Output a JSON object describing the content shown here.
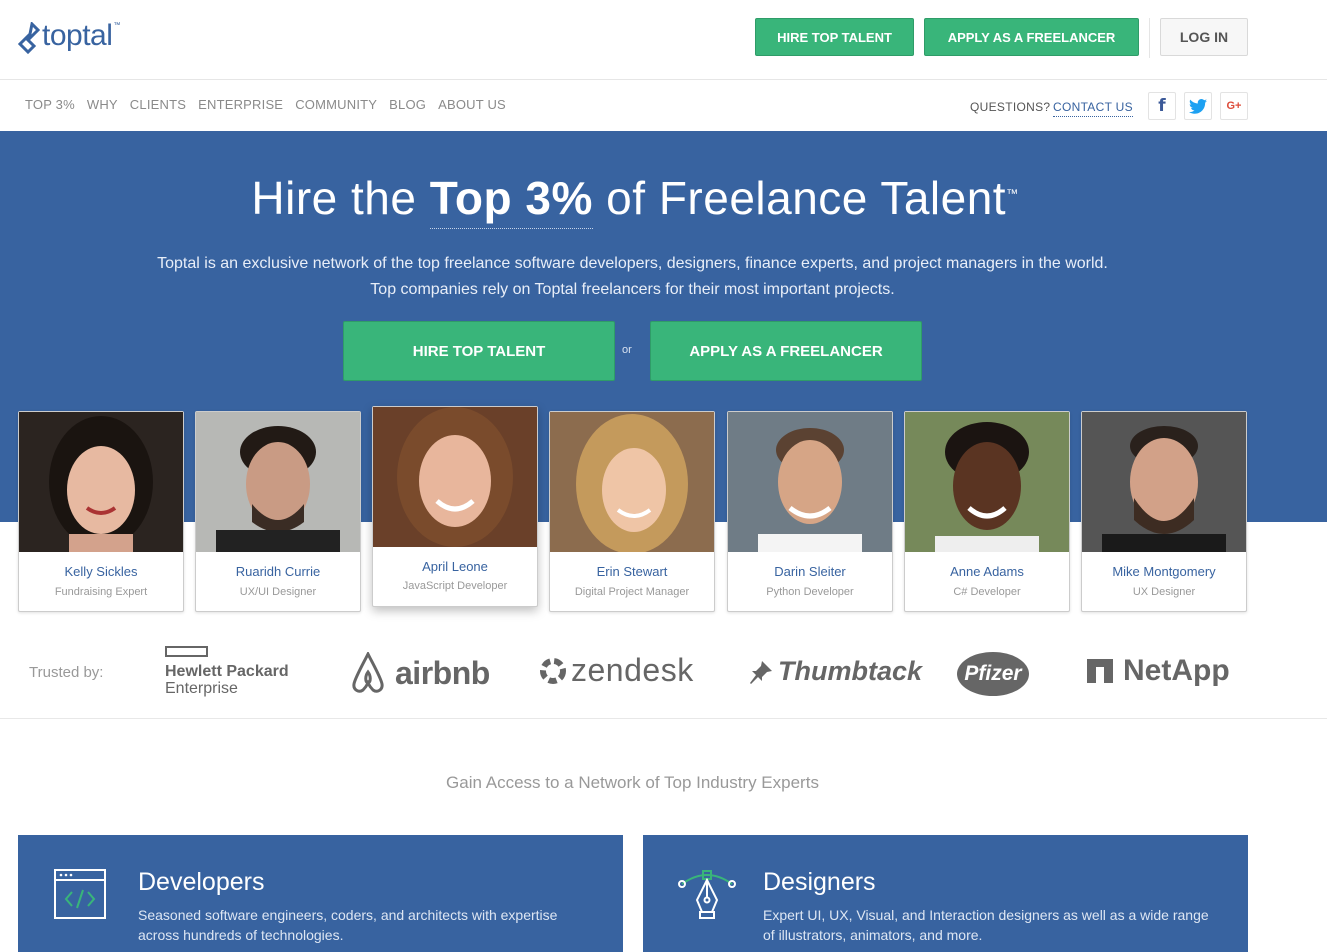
{
  "brand": {
    "name": "toptal",
    "tm": "™"
  },
  "header": {
    "hire_label": "HIRE TOP TALENT",
    "apply_label": "APPLY AS A FREELANCER",
    "login_label": "LOG IN"
  },
  "nav": {
    "items": [
      "TOP 3%",
      "WHY",
      "CLIENTS",
      "ENTERPRISE",
      "COMMUNITY",
      "BLOG",
      "ABOUT US"
    ],
    "questions": "QUESTIONS?",
    "contact": "CONTACT US",
    "social": {
      "facebook": "f",
      "twitter": "twitter-icon",
      "google_plus": "G+"
    }
  },
  "hero": {
    "title_pre": "Hire the ",
    "title_strong": "Top 3%",
    "title_post": " of Freelance Talent",
    "title_tm": "™",
    "subtitle_line1": "Toptal is an exclusive network of the top freelance software developers, designers, finance experts, and project managers in the world.",
    "subtitle_line2": "Top companies rely on Toptal freelancers for their most important projects.",
    "hire_label": "HIRE TOP TALENT",
    "or_label": "or",
    "apply_label": "APPLY AS A FREELANCER"
  },
  "talent": [
    {
      "name": "Kelly Sickles",
      "role": "Fundraising Expert"
    },
    {
      "name": "Ruaridh Currie",
      "role": "UX/UI Designer"
    },
    {
      "name": "April Leone",
      "role": "JavaScript Developer"
    },
    {
      "name": "Erin Stewart",
      "role": "Digital Project Manager"
    },
    {
      "name": "Darin Sleiter",
      "role": "Python Developer"
    },
    {
      "name": "Anne Adams",
      "role": "C# Developer"
    },
    {
      "name": "Mike Montgomery",
      "role": "UX Designer"
    }
  ],
  "trusted": {
    "label": "Trusted by:",
    "hpe_line1": "Hewlett Packard",
    "hpe_line2": "Enterprise",
    "airbnb": "airbnb",
    "zendesk": "zendesk",
    "thumbtack": "Thumbtack",
    "pfizer": "Pfizer",
    "netapp": "NetApp"
  },
  "section": {
    "title": "Gain Access to a Network of Top Industry Experts",
    "panels": [
      {
        "title": "Developers",
        "desc": "Seasoned software engineers, coders, and architects with expertise across hundreds of technologies."
      },
      {
        "title": "Designers",
        "desc": "Expert UI, UX, Visual, and Interaction designers as well as a wide range of illustrators, animators, and more."
      }
    ]
  },
  "colors": {
    "brand_blue": "#3863a0",
    "accent_green": "#39b57a",
    "facebook": "#3b5998",
    "twitter": "#1da1f2",
    "google_plus": "#dd4b39"
  }
}
